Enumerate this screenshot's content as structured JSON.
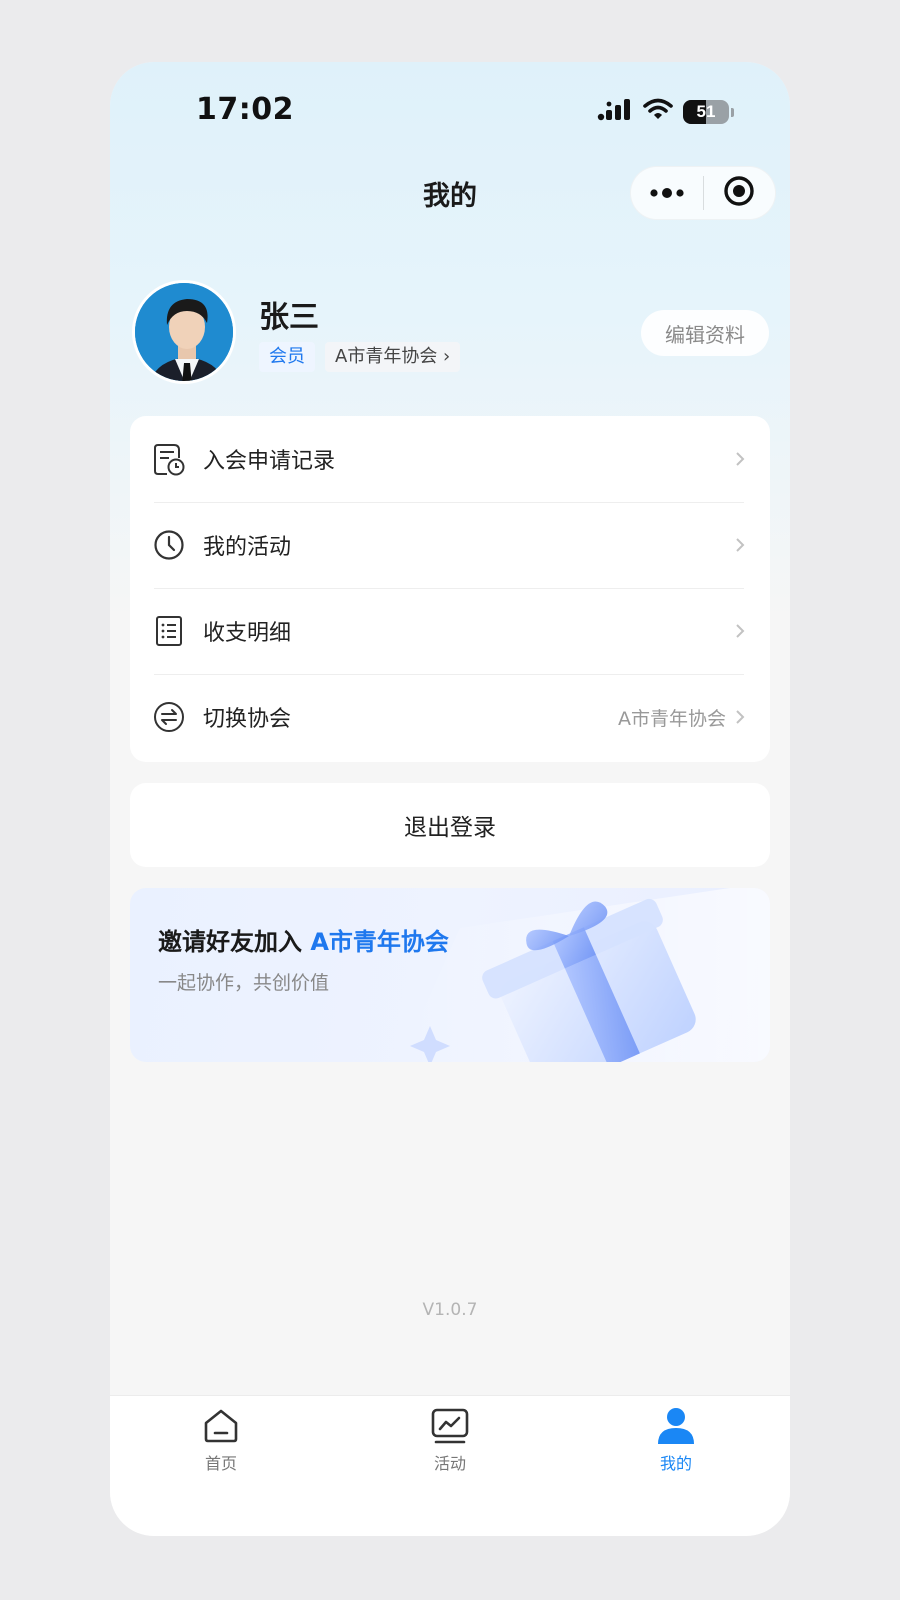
{
  "status_bar": {
    "time": "17:02",
    "battery_level": "51",
    "icons": [
      "signal-icon",
      "wifi-icon",
      "battery-icon"
    ]
  },
  "nav": {
    "title": "我的",
    "capsule_icons": [
      "more-dots-icon",
      "close-target-icon"
    ]
  },
  "profile": {
    "name": "张三",
    "role_tag": "会员",
    "association_tag": "A市青年协会 ›",
    "edit_button": "编辑资料"
  },
  "menu": {
    "items": [
      {
        "label": "入会申请记录",
        "icon": "application-record-icon",
        "value": ""
      },
      {
        "label": "我的活动",
        "icon": "clock-icon",
        "value": ""
      },
      {
        "label": "收支明细",
        "icon": "list-document-icon",
        "value": ""
      },
      {
        "label": "切换协会",
        "icon": "switch-icon",
        "value": "A市青年协会"
      }
    ]
  },
  "logout": {
    "label": "退出登录"
  },
  "invite": {
    "title_prefix": "邀请好友加入 ",
    "title_highlight": "A市青年协会",
    "subtitle": "一起协作，共创价值"
  },
  "version": "V1.0.7",
  "tabbar": {
    "tabs": [
      {
        "label": "首页",
        "icon": "home-icon",
        "active": false
      },
      {
        "label": "活动",
        "icon": "activity-chart-icon",
        "active": false
      },
      {
        "label": "我的",
        "icon": "person-icon",
        "active": true
      }
    ]
  },
  "colors": {
    "accent": "#1f78ee",
    "tab_active": "#1a87f5",
    "page_bg": "#f6f6f6",
    "header_gradient_top": "#dff1fa"
  }
}
